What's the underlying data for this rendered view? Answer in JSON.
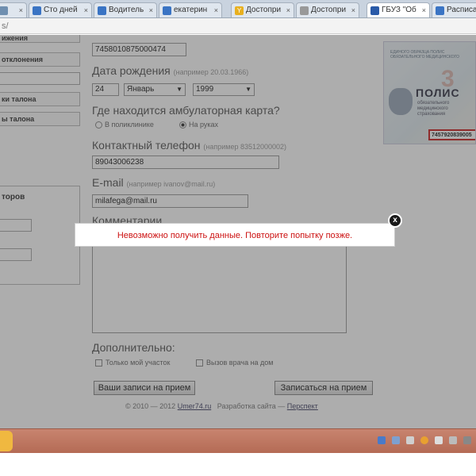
{
  "browser": {
    "tabs": [
      {
        "label": "",
        "color": "#6f8fb0",
        "active": false
      },
      {
        "label": "Сто дней",
        "color": "#3a74c4",
        "active": false
      },
      {
        "label": "Водитель",
        "color": "#3a74c4",
        "active": false
      },
      {
        "label": "екатерин",
        "color": "#3a74c4",
        "active": false
      },
      {
        "label": "Достопри",
        "color": "#e8b020",
        "active": false
      },
      {
        "label": "Достопри",
        "color": "#999999",
        "active": false
      },
      {
        "label": "ГБУЗ \"Об",
        "color": "#2a5aa8",
        "active": true
      },
      {
        "label": "Расписа",
        "color": "#3a74c4",
        "active": false
      }
    ],
    "address": "s/"
  },
  "sidebar": {
    "items": [
      "ижения",
      "отклонения",
      "ки талона",
      "ы талона"
    ],
    "panel_label": "торов"
  },
  "form": {
    "policy_number": "7458010875000474",
    "dob_label": "Дата рождения",
    "dob_hint": "(например 20.03.1966)",
    "dob_day": "24",
    "dob_month": "Январь",
    "dob_year": "1999",
    "card_label": "Где находится амбулаторная карта?",
    "card_options": [
      "В поликлинике",
      "На руках"
    ],
    "card_selected": 1,
    "phone_label": "Контактный телефон",
    "phone_hint": "(например 83512000002)",
    "phone_value": "89043006238",
    "email_label": "E-mail",
    "email_hint": "(например ivanov@mail.ru)",
    "email_value": "milafega@mail.ru",
    "comment_label": "Комментарии",
    "additional_label": "Дополнительно:",
    "additional_options": [
      "Только мой участок",
      "Вызов врача на дом"
    ],
    "btn_my_records": "Ваши записи на прием",
    "btn_book": "Записаться на прием"
  },
  "footer": {
    "copyright": "© 2010 — 2012",
    "site_link": "Umer74.ru",
    "dev_text": "Разработка сайта —",
    "dev_link": "Перспект"
  },
  "polis_card": {
    "lines": "ЕДИНОГО ОБРАЗЦА ПОЛИС ОБЯЗАТЕЛЬНОГО МЕДИЦИНСКОГО",
    "title": "ПОЛИС",
    "subtitle": "обязательного медицинского страхования",
    "number": "7457920839005"
  },
  "dialog": {
    "message": "Невозможно получить данные. Повторите попытку позже.",
    "close_glyph": "x"
  }
}
